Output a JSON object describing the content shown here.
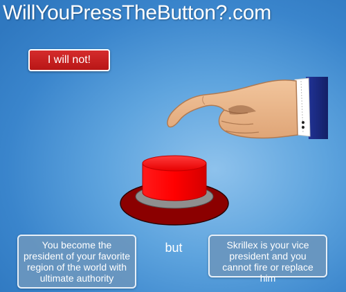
{
  "site": {
    "title": "WillYouPressTheButton?.com"
  },
  "actions": {
    "refuse_label": "I will not!"
  },
  "dilemma": {
    "benefit": "You become the president of your favorite region of the world with ultimate authority",
    "connector": "but",
    "consequence": "Skrillex is your vice president and you cannot fire or replace him"
  },
  "colors": {
    "background": "#5ea4de",
    "button_red": "#ff0000",
    "button_base": "#8b0000",
    "refuse_button": "#c81e1e",
    "box_fill": "#6a96be",
    "sleeve": "#1e2d80"
  },
  "icons": {
    "hand": "pointing-hand-icon",
    "button": "big-red-button"
  }
}
